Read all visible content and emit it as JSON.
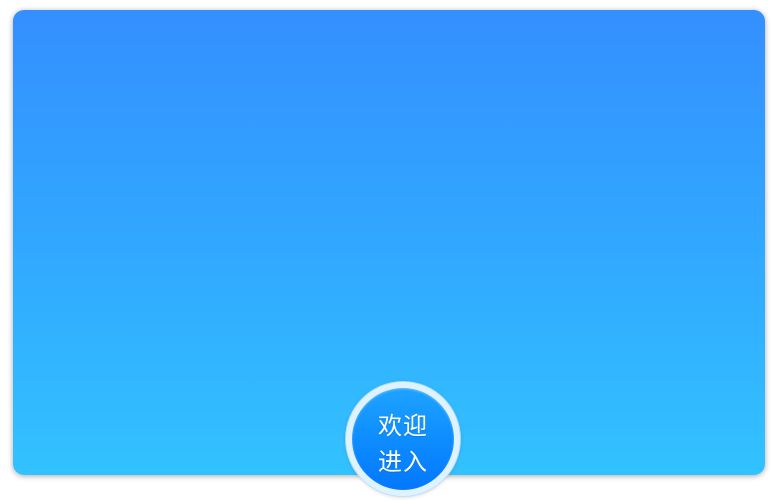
{
  "window": {
    "background_top": "#348fff",
    "background_bottom": "#32c2ff"
  },
  "enter_button": {
    "line1": "欢迎",
    "line2": "进入",
    "fill_top": "#1ea3ff",
    "fill_bottom": "#0377ff",
    "ring_color": "#dff2ff"
  }
}
